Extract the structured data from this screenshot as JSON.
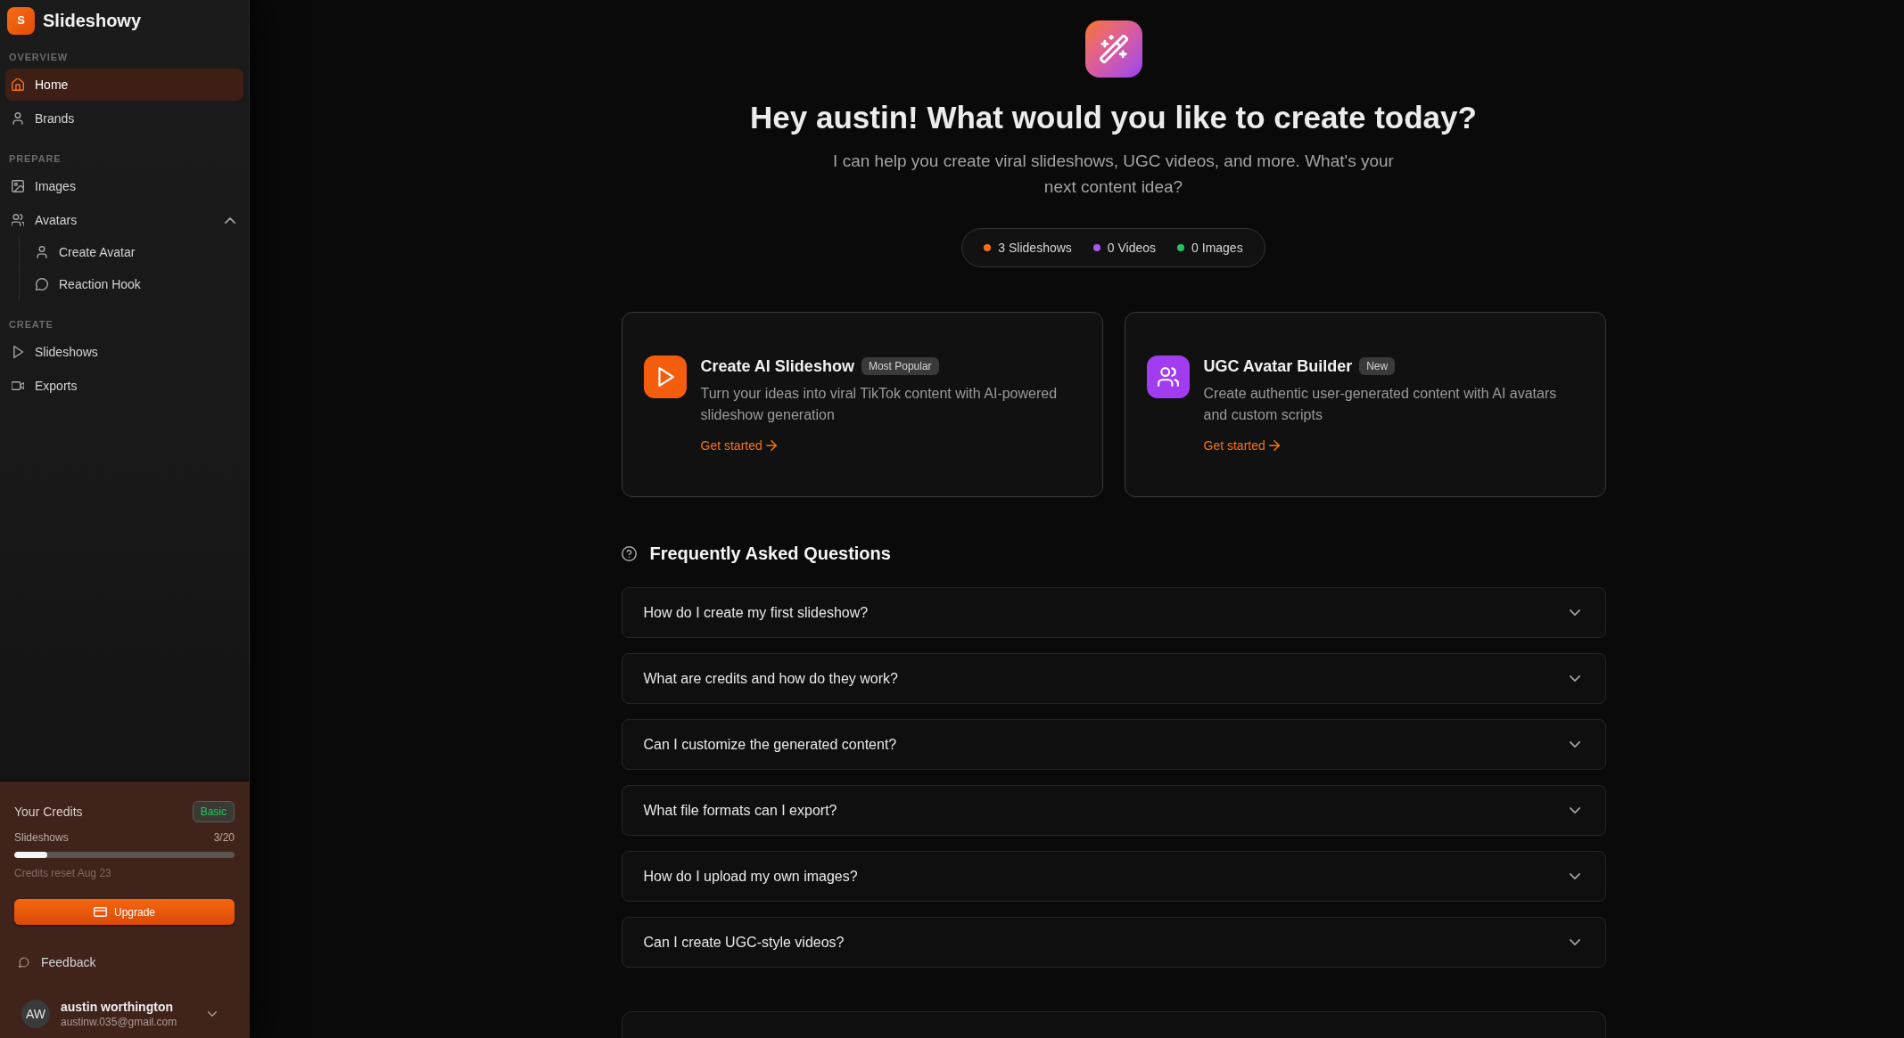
{
  "sidebar": {
    "logo": {
      "letter": "S",
      "name": "Slideshowy"
    },
    "sections": [
      {
        "title": "OVERVIEW",
        "items": [
          {
            "label": "Home",
            "selected": true
          },
          {
            "label": "Brands",
            "selected": false
          }
        ]
      },
      {
        "title": "PREPARE",
        "items": [
          {
            "label": "Images",
            "selected": false
          },
          {
            "label": "Avatars",
            "selected": false,
            "expanded": true,
            "children": [
              {
                "label": "Create Avatar",
                "selected": false
              },
              {
                "label": "Reaction Hook",
                "selected": false
              }
            ]
          }
        ]
      },
      {
        "title": "CREATE",
        "items": [
          {
            "label": "Slideshows",
            "selected": false
          },
          {
            "label": "Exports",
            "selected": false
          }
        ]
      }
    ],
    "credits": {
      "title": "Your Credits",
      "plan": "Basic",
      "meter": {
        "label": "Slideshows",
        "count": "3/20",
        "level": 0.15
      },
      "reset_note": "Credits reset Aug 23",
      "upgrade_button": "Upgrade"
    },
    "feedback": "Feedback",
    "user": {
      "initials": "AW",
      "name": "austin worthington",
      "email": "austinw.035@gmail.com"
    }
  },
  "main": {
    "heading": "Hey austin! What would you like to create today?",
    "subtitle": "I can help you create viral slideshows, UGC videos, and more. What's your next content idea?",
    "stats": [
      {
        "label": "3 Slideshows",
        "color": "#f97316"
      },
      {
        "label": "0 Videos",
        "color": "#a855f7"
      },
      {
        "label": "0 Images",
        "color": "#22c55e"
      }
    ],
    "cards": [
      {
        "title": "Create AI Slideshow",
        "badge": "Most Popular",
        "description": "Turn your ideas into viral TikTok content with AI-powered slideshow generation",
        "link": "Get started",
        "color": "#f45d0e"
      },
      {
        "title": "UGC Avatar Builder",
        "badge": "New",
        "description": "Create authentic user-generated content with AI avatars and custom scripts",
        "link": "Get started",
        "color": "#a23cf0"
      }
    ],
    "faq": {
      "title": "Frequently Asked Questions",
      "items": [
        {
          "question": "How do I create my first slideshow?",
          "expanded": false
        },
        {
          "question": "What are credits and how do they work?",
          "expanded": false
        },
        {
          "question": "Can I customize the generated content?",
          "expanded": false
        },
        {
          "question": "What file formats can I export?",
          "expanded": false
        },
        {
          "question": "How do I upload my own images?",
          "expanded": false
        },
        {
          "question": "Can I create UGC-style videos?",
          "expanded": false
        }
      ]
    }
  }
}
